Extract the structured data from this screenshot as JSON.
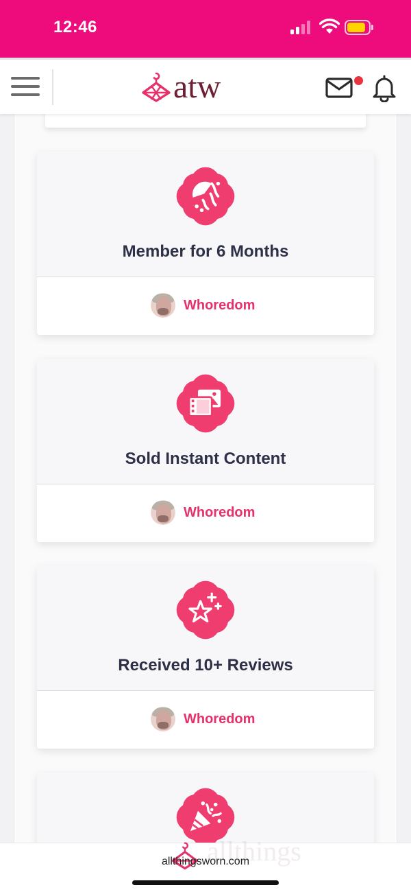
{
  "status_bar": {
    "time": "12:46",
    "battery_color": "#ffd400",
    "background": "#ee0c7c"
  },
  "header": {
    "logo_text": "atw",
    "menu_icon": "hamburger-icon",
    "mail_icon": "mail-icon",
    "notification_icon": "bell-icon",
    "mail_unread": true
  },
  "badges": [
    {
      "title": "Member for 6 Months",
      "icon": "confetti-moon-icon",
      "user": "Whoredom"
    },
    {
      "title": "Sold Instant Content",
      "icon": "media-gallery-icon",
      "user": "Whoredom"
    },
    {
      "title": "Received 10+ Reviews",
      "icon": "star-sparkle-icon",
      "user": "Whoredom"
    },
    {
      "icon": "party-popper-icon"
    }
  ],
  "browser": {
    "url": "allthingsworn.com",
    "watermark": "allthings"
  },
  "colors": {
    "accent": "#e6316b",
    "title": "#2e3047",
    "logo": "#6d1f33"
  }
}
